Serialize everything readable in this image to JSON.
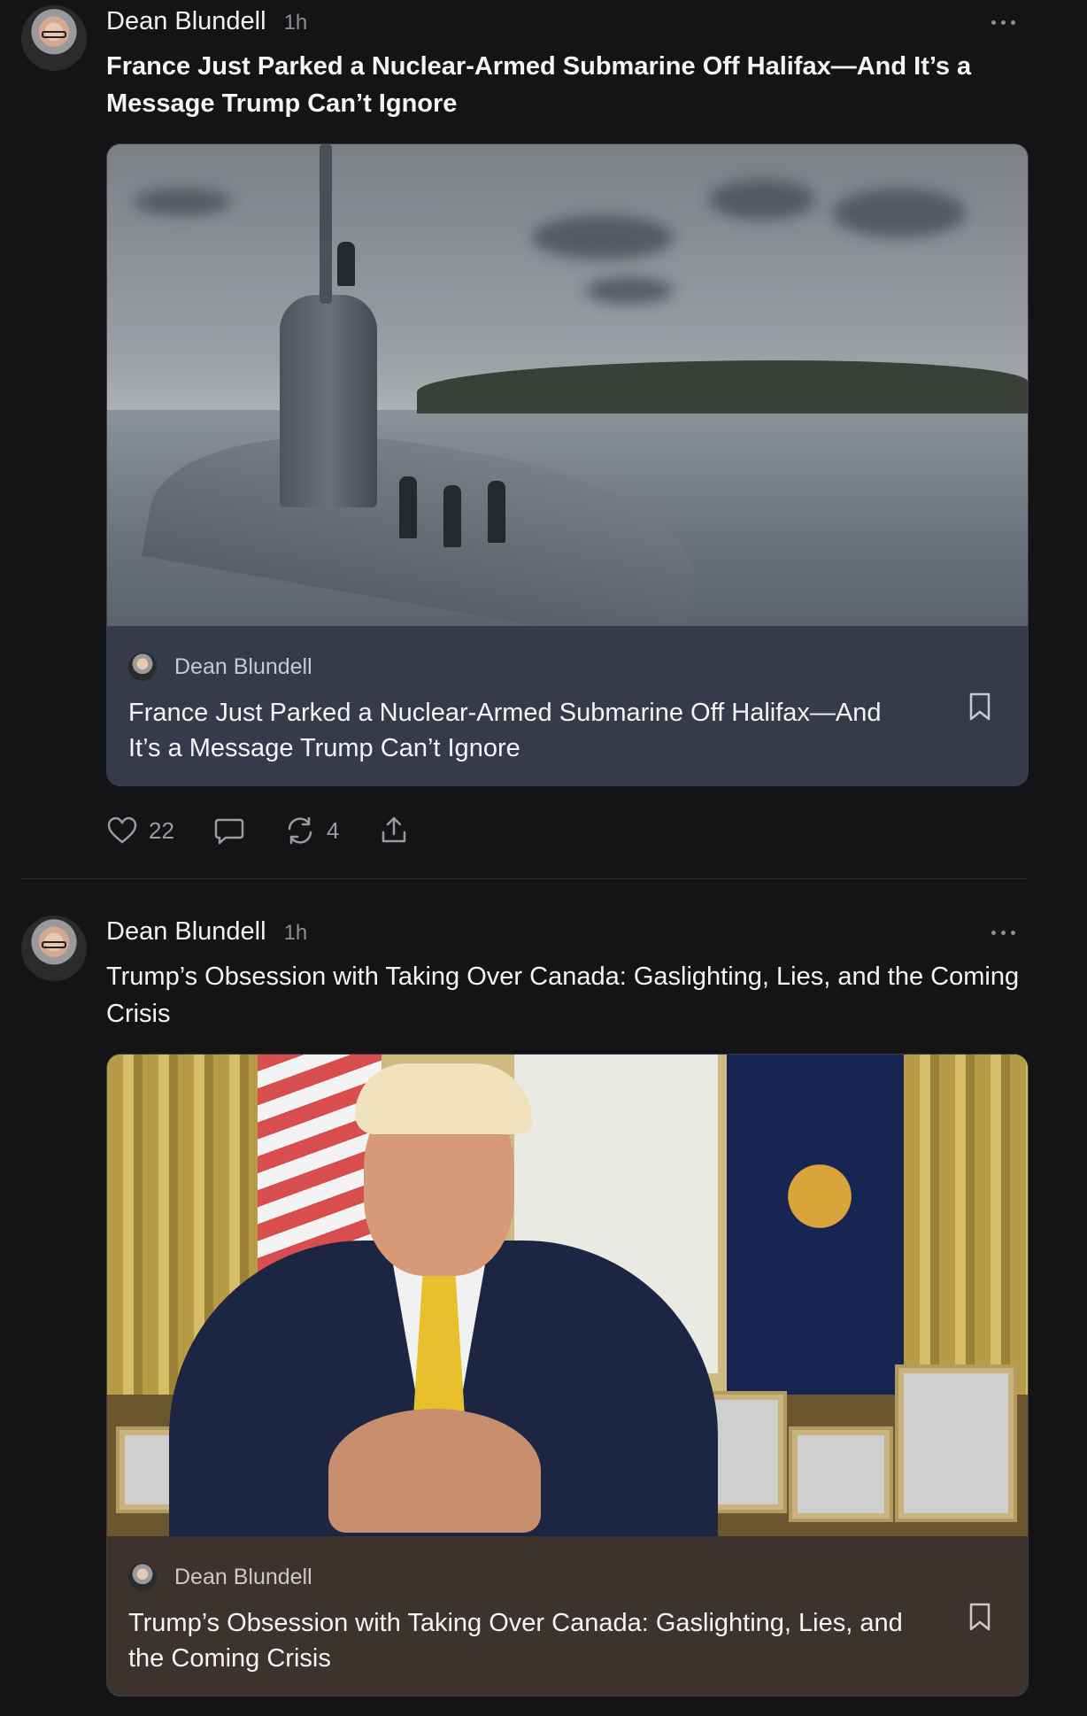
{
  "posts": [
    {
      "author": "Dean Blundell",
      "time": "1h",
      "title": "France Just Parked a Nuclear-Armed Submarine Off Halifax—And It’s a Message Trump Can’t Ignore",
      "card": {
        "author": "Dean Blundell",
        "title": "France Just Parked a Nuclear-Armed Submarine Off Halifax—And It’s a Message Trump Can’t Ignore",
        "background": "#363a4a"
      },
      "actions": {
        "likes": "22",
        "comments": "",
        "restacks": "4"
      }
    },
    {
      "author": "Dean Blundell",
      "time": "1h",
      "title": "Trump’s Obsession with Taking Over Canada: Gaslighting, Lies, and the Coming Crisis",
      "card": {
        "author": "Dean Blundell",
        "title": "Trump’s Obsession with Taking Over Canada: Gaslighting, Lies, and the Coming Crisis",
        "background": "#3e322d"
      }
    }
  ],
  "icons": {
    "more": "more-horizontal-icon",
    "bookmark": "bookmark-icon",
    "like": "heart-icon",
    "comment": "comment-icon",
    "restack": "restack-icon",
    "share": "share-icon"
  }
}
